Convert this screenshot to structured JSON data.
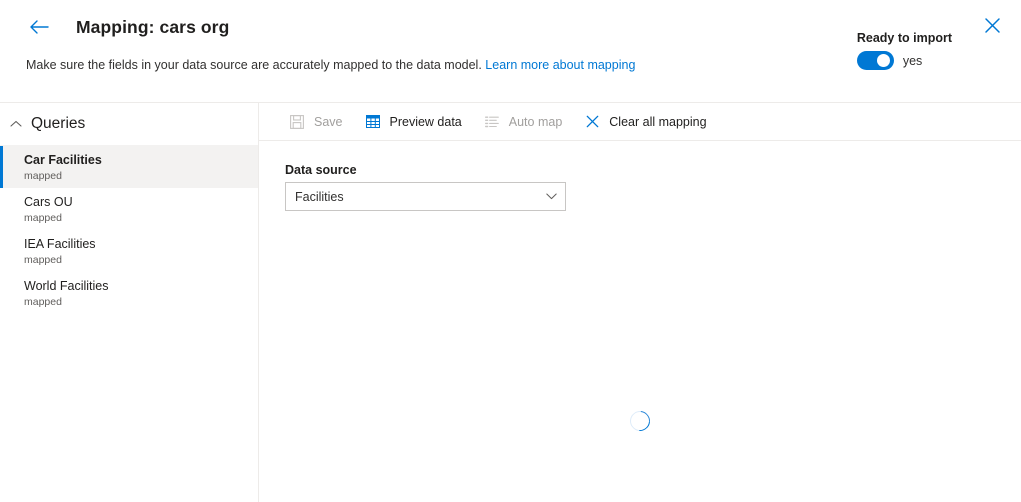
{
  "header": {
    "back_icon": "arrow-left-icon",
    "title": "Mapping: cars org",
    "description": "Make sure the fields in your data source are accurately mapped to the data model.",
    "link_text": "Learn more about mapping",
    "ready_label": "Ready to import",
    "toggle_state": "yes",
    "close_icon": "close-icon",
    "accent_color": "#0078d4"
  },
  "sidebar": {
    "section_title": "Queries",
    "collapse_icon": "chevron-up-icon",
    "items": [
      {
        "name": "Car Facilities",
        "status": "mapped",
        "selected": true
      },
      {
        "name": "Cars OU",
        "status": "mapped",
        "selected": false
      },
      {
        "name": "IEA Facilities",
        "status": "mapped",
        "selected": false
      },
      {
        "name": "World Facilities",
        "status": "mapped",
        "selected": false
      }
    ]
  },
  "toolbar": {
    "save_label": "Save",
    "save_icon": "save-icon",
    "preview_label": "Preview data",
    "preview_icon": "table-grid-icon",
    "automap_label": "Auto map",
    "automap_icon": "list-icon",
    "clear_label": "Clear all mapping",
    "clear_icon": "close-x-icon"
  },
  "main": {
    "data_source_label": "Data source",
    "data_source_value": "Facilities",
    "dropdown_icon": "chevron-down-icon",
    "loading_icon": "spinner-icon"
  }
}
